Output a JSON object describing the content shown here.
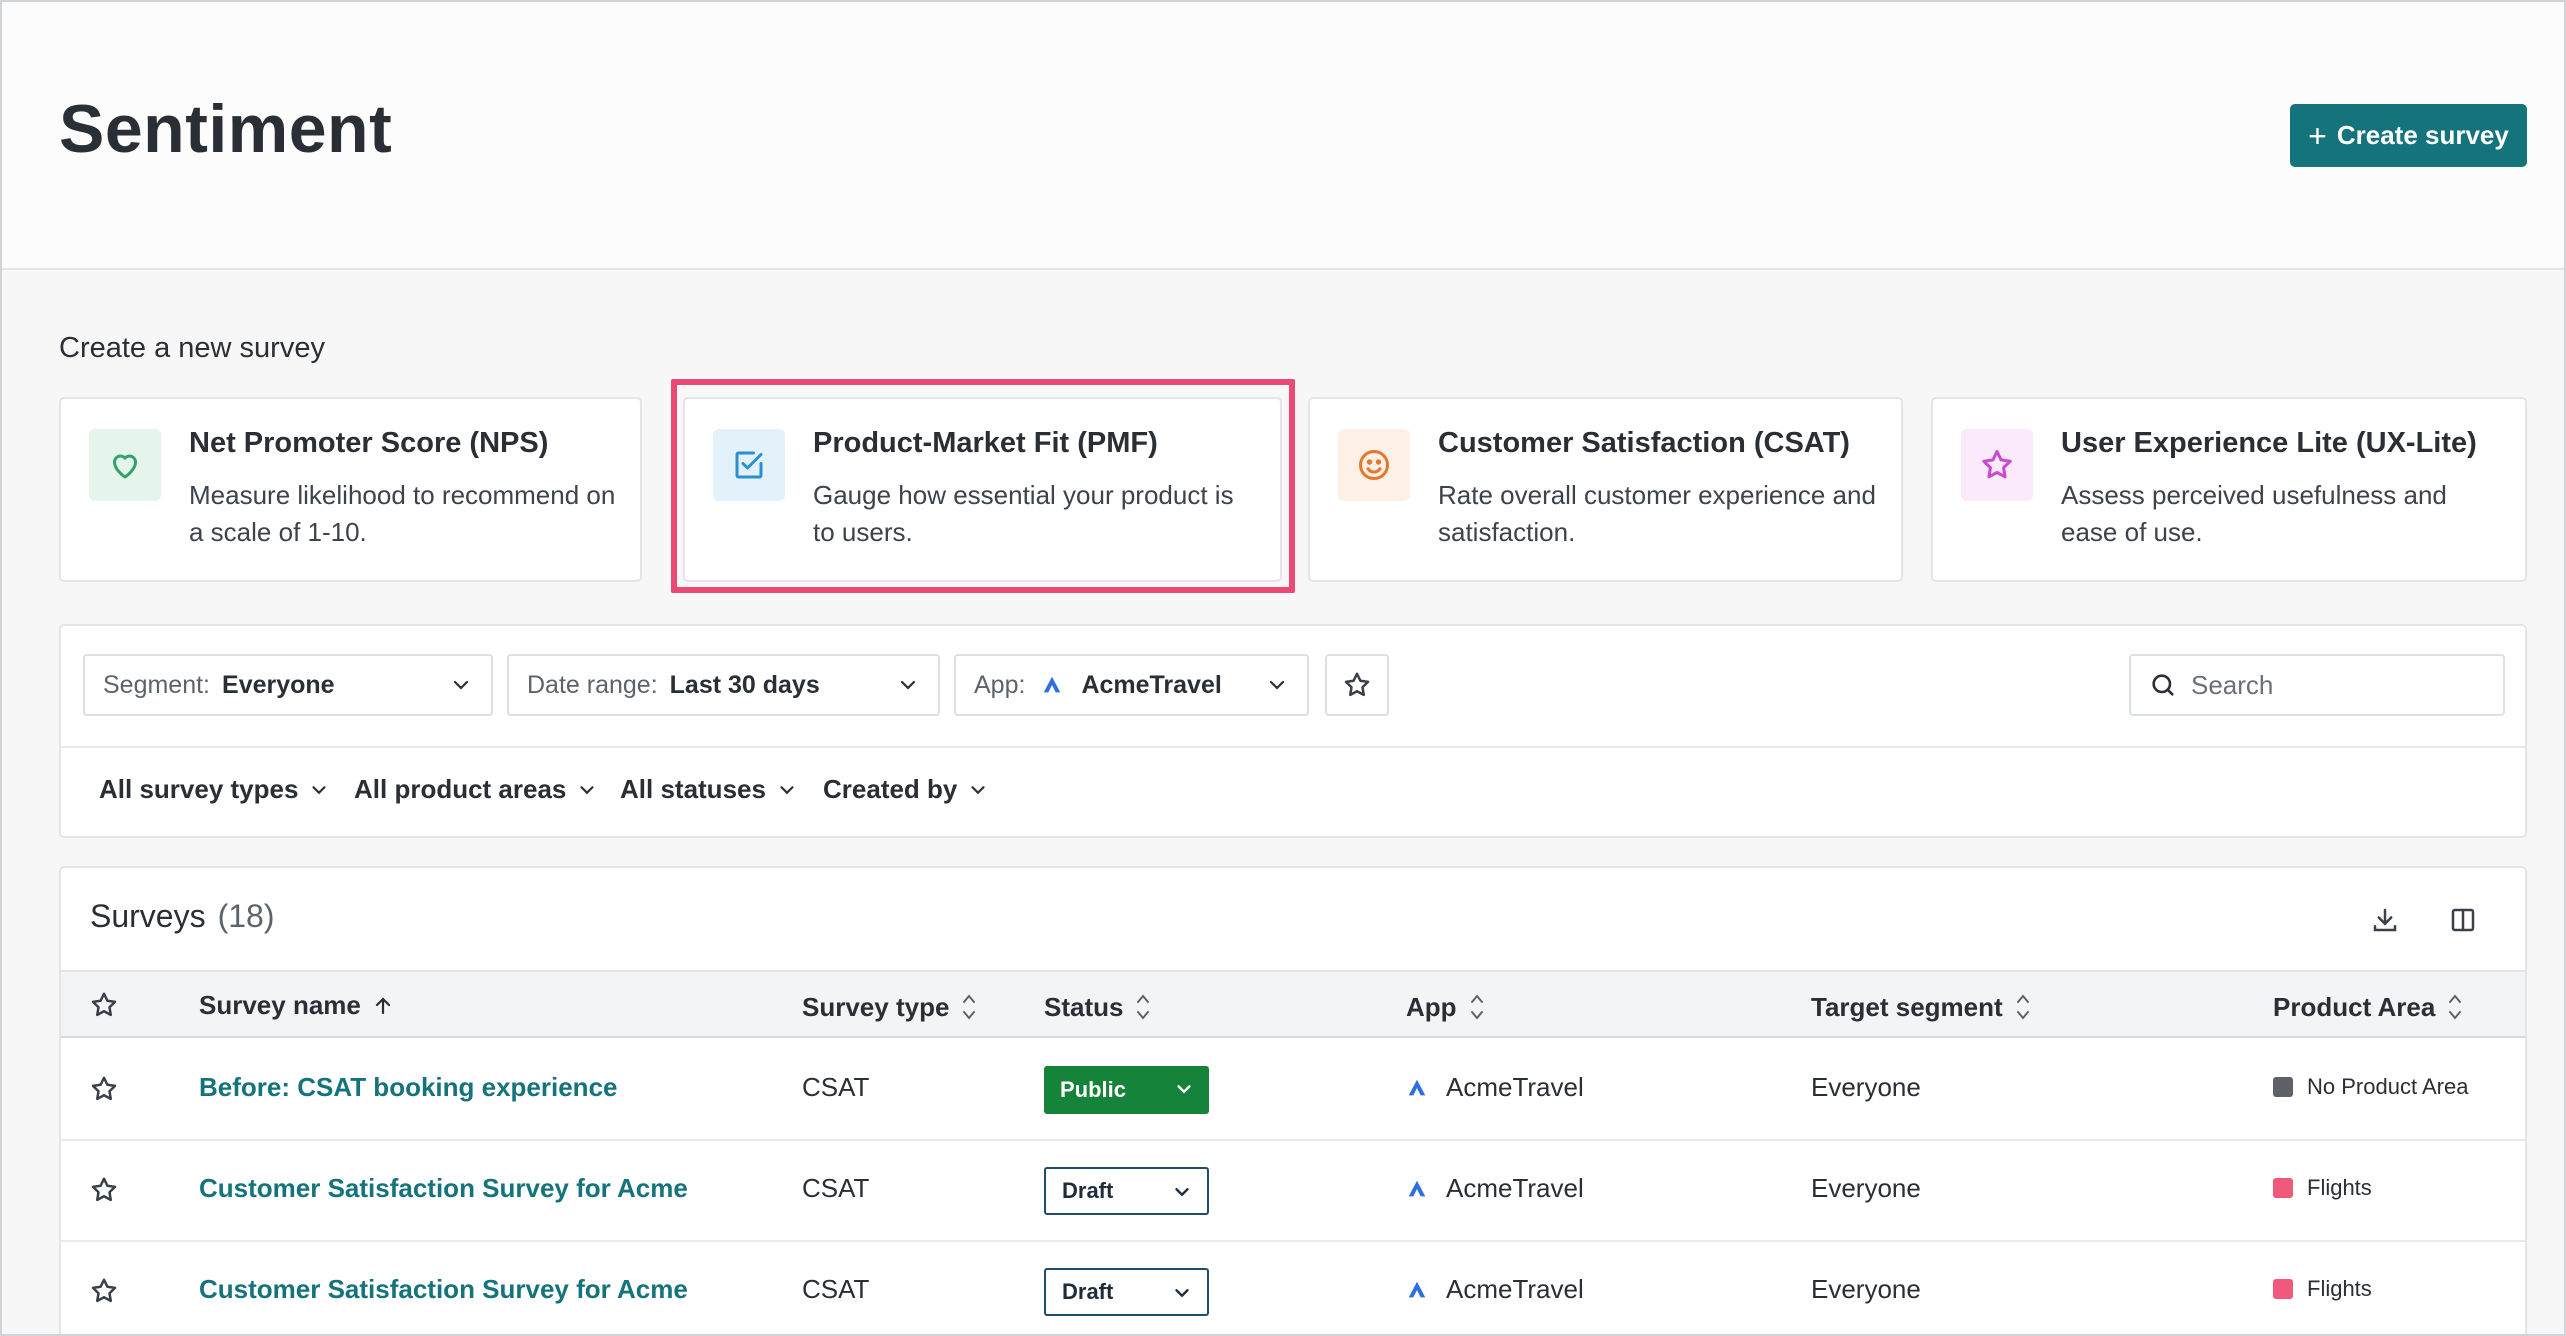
{
  "header": {
    "title": "Sentiment",
    "create_button": "Create survey",
    "create_button_icon": "+"
  },
  "create_section": {
    "label": "Create a new survey",
    "cards": [
      {
        "title": "Net Promoter Score (NPS)",
        "description": "Measure likelihood to recommend on a scale of 1-10.",
        "icon": "heart-icon",
        "icon_color": "#2fa36b",
        "icon_bg": "#e6f5ec"
      },
      {
        "title": "Product-Market Fit (PMF)",
        "description": "Gauge how essential your product is to users.",
        "icon": "checkbox-icon",
        "icon_color": "#2b8fcf",
        "icon_bg": "#e3f1fb"
      },
      {
        "title": "Customer Satisfaction (CSAT)",
        "description": "Rate overall customer experience and satisfaction.",
        "icon": "smiley-icon",
        "icon_color": "#e8772e",
        "icon_bg": "#fdf0e6"
      },
      {
        "title": "User Experience Lite (UX-Lite)",
        "description": "Assess perceived usefulness and ease of use.",
        "icon": "star-icon",
        "icon_color": "#c94ad1",
        "icon_bg": "#fbeafc"
      }
    ]
  },
  "filters": {
    "segment": {
      "label": "Segment:",
      "value": "Everyone"
    },
    "date_range": {
      "label": "Date range:",
      "value": "Last 30 days"
    },
    "app": {
      "label": "App:",
      "value": "AcmeTravel"
    },
    "search_placeholder": "Search",
    "dropdowns": [
      "All survey types",
      "All product areas",
      "All statuses",
      "Created by"
    ]
  },
  "surveys": {
    "title": "Surveys",
    "count": "(18)",
    "columns": [
      "Survey name",
      "Survey type",
      "Status",
      "App",
      "Target segment",
      "Product Area"
    ],
    "rows": [
      {
        "name": "Before: CSAT booking experience",
        "type": "CSAT",
        "status": "Public",
        "app": "AcmeTravel",
        "segment": "Everyone",
        "product_area": "No Product Area",
        "pa_color": "#5e6167"
      },
      {
        "name": "Customer Satisfaction Survey for Acme",
        "type": "CSAT",
        "status": "Draft",
        "app": "AcmeTravel",
        "segment": "Everyone",
        "product_area": "Flights",
        "pa_color": "#f0587c"
      },
      {
        "name": "Customer Satisfaction Survey for Acme",
        "type": "CSAT",
        "status": "Draft",
        "app": "AcmeTravel",
        "segment": "Everyone",
        "product_area": "Flights",
        "pa_color": "#f0587c"
      }
    ]
  },
  "colors": {
    "accent": "#15737c",
    "highlight": "#ec4873",
    "public": "#16833a"
  }
}
